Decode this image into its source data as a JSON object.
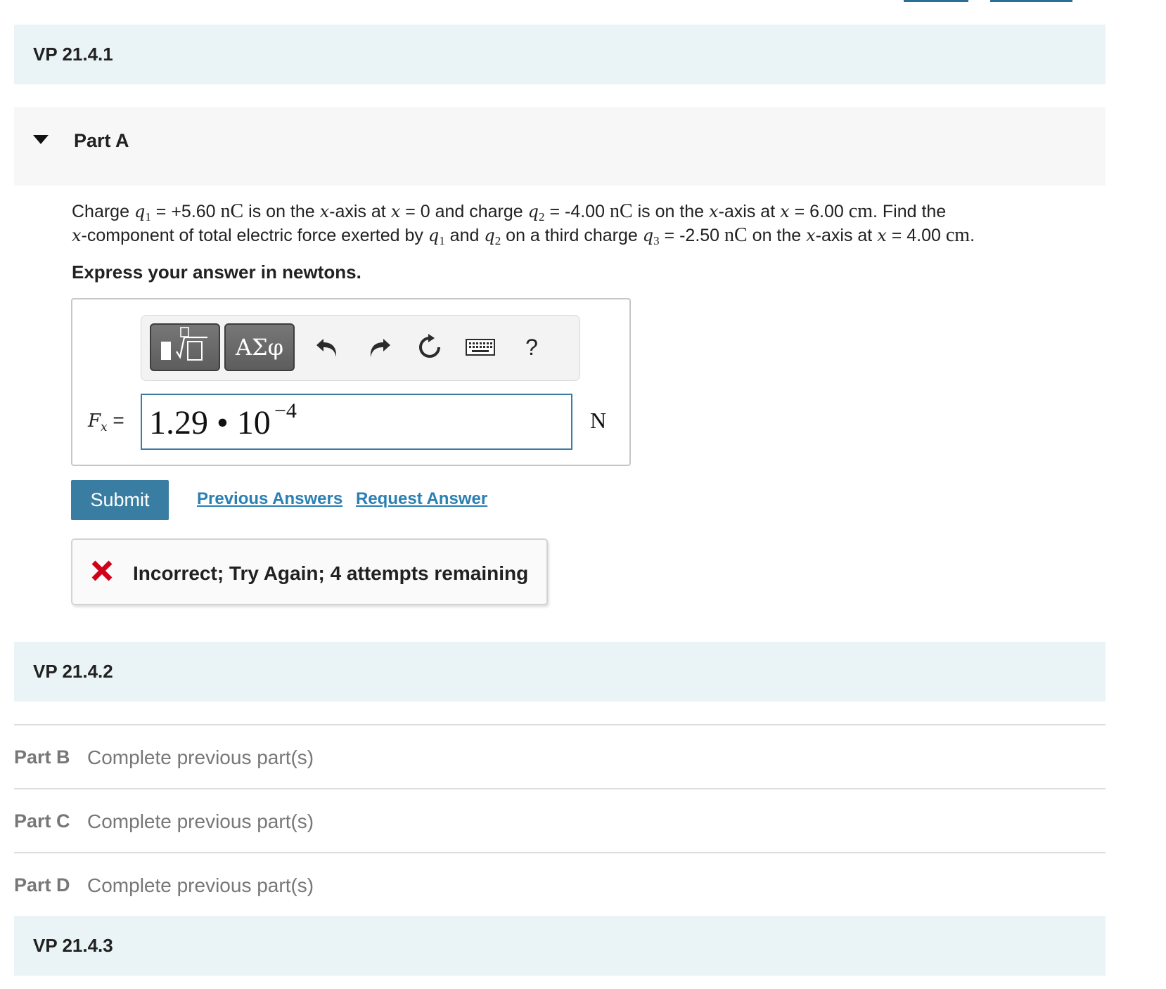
{
  "top_links": [
    "",
    ""
  ],
  "sections": {
    "vp1": "VP 21.4.1",
    "vp2": "VP 21.4.2",
    "vp3": "VP 21.4.3"
  },
  "part_a": {
    "title": "Part A",
    "question": {
      "t1": "Charge ",
      "q1": "q",
      "q1_sub": "1",
      "t2": " = +5.60 ",
      "u1": "nC",
      "t3": " is on the ",
      "x1": "x",
      "t4": "-axis at ",
      "x2": "x",
      "t5": " = 0 and charge ",
      "q2": "q",
      "q2_sub": "2",
      "t6": " = -4.00 ",
      "u2": "nC",
      "t7": " is on the ",
      "x3": "x",
      "t8": "-axis at ",
      "x4": "x",
      "t9": " = 6.00 ",
      "u3": "cm",
      "t10": ". Find the ",
      "x5": "x",
      "t11": "-component of total electric force exerted by ",
      "q3": "q",
      "q3_sub": "1",
      "t12": " and ",
      "q4": "q",
      "q4_sub": "2",
      "t13": " on a third charge ",
      "q5": "q",
      "q5_sub": "3",
      "t14": " = -2.50 ",
      "u4": "nC",
      "t15": " on the ",
      "x6": "x",
      "t16": "-axis at ",
      "x7": "x",
      "t17": " = 4.00 ",
      "u5": "cm",
      "t18": "."
    },
    "instruction": "Express your answer in newtons.",
    "toolbar": {
      "greek_label": "ΑΣφ",
      "help_label": "?"
    },
    "answer": {
      "var": "F",
      "var_sub": "x",
      "equals": "=",
      "mantissa": "1.29 • 10",
      "exponent": "−4",
      "unit": "N"
    },
    "submit_label": "Submit",
    "previous_answers_label": "Previous Answers",
    "request_answer_label": "Request Answer",
    "feedback": "Incorrect; Try Again; 4 attempts remaining",
    "colors": {
      "section_bg": "#eaf4f7",
      "accent": "#3a7da2",
      "link": "#2a7fb3",
      "error": "#d0021b"
    }
  },
  "locked_parts": [
    {
      "label": "Part B",
      "status": "Complete previous part(s)"
    },
    {
      "label": "Part C",
      "status": "Complete previous part(s)"
    },
    {
      "label": "Part D",
      "status": "Complete previous part(s)"
    }
  ]
}
